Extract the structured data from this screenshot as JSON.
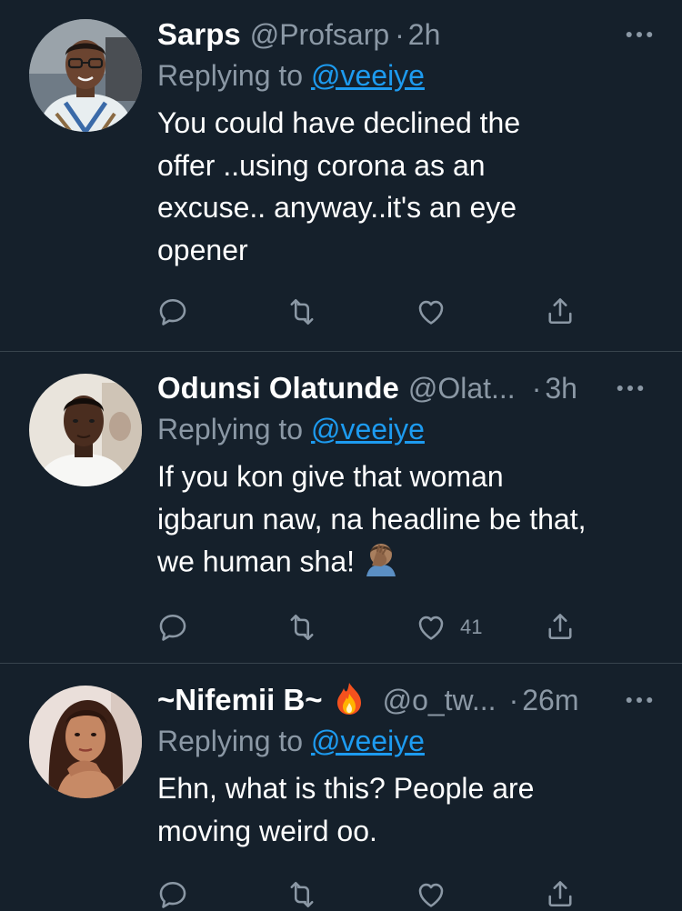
{
  "tweets": [
    {
      "name": "Sarps",
      "handle": "@Profsarp",
      "dot": "·",
      "time": "2h",
      "replying_prefix": "Replying to ",
      "replying_to": "@veeiye",
      "lines": [
        "You could have declined the",
        "offer ..using corona as an",
        "excuse.. anyway..it's an eye",
        "opener"
      ],
      "likes": ""
    },
    {
      "name": "Odunsi Olatunde",
      "handle": "@Olat...",
      "dot": "·",
      "time": "3h",
      "replying_prefix": "Replying to ",
      "replying_to": "@veeiye",
      "lines": [
        "If you kon give that woman",
        "igbarun naw, na headline be that,",
        "we human sha!"
      ],
      "likes": "41"
    },
    {
      "name": "~Nifemii B~",
      "handle": "@o_tw...",
      "dot": "·",
      "time": "26m",
      "replying_prefix": "Replying to ",
      "replying_to": "@veeiye",
      "lines": [
        "Ehn, what is this? People are",
        "moving weird oo."
      ],
      "likes": ""
    }
  ],
  "icons": {
    "more": "more-horizontal-icon",
    "reply": "reply-icon",
    "retweet": "retweet-icon",
    "like": "heart-icon",
    "share": "share-icon",
    "facepalm": "facepalm-emoji",
    "fire": "fire-emoji"
  },
  "colors": {
    "background": "#15202b",
    "divider": "#38444d",
    "secondary_text": "#8b98a5",
    "link": "#1d9bf0",
    "primary_text": "#ffffff"
  }
}
